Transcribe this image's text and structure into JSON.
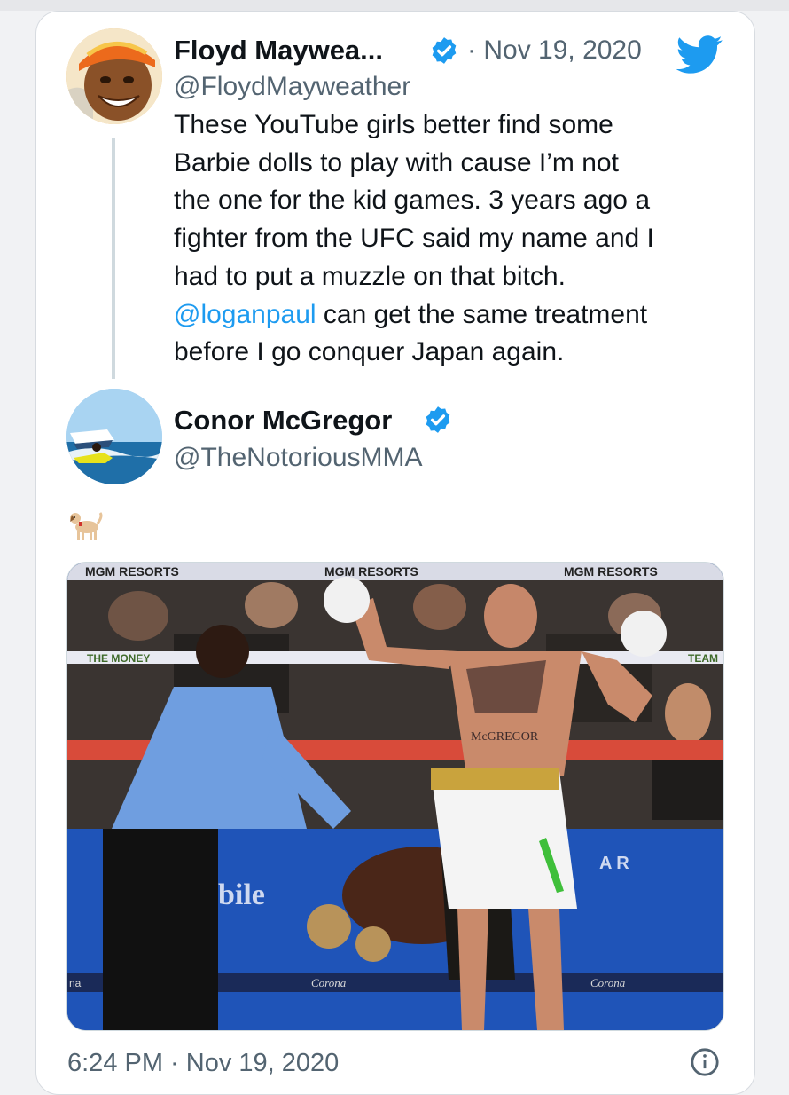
{
  "tweet": {
    "author_name": "Floyd Maywea...",
    "author_handle": "@FloydMayweather",
    "separator": "·",
    "date": "Nov 19, 2020",
    "body_lines": [
      "These YouTube girls better find some",
      "Barbie dolls to play with cause I’m not",
      "the one for the kid games. 3 years ago a",
      "fighter from the UFC said my name and I",
      "had to put a muzzle on that bitch."
    ],
    "mention": "@loganpaul",
    "mention_rest": " can get the same treatment",
    "last_line": "before I go conquer Japan again.",
    "icons": {
      "avatar": "avatar",
      "verified": "verified-badge-icon",
      "platform": "twitter-bird-icon"
    }
  },
  "reply": {
    "author_name": "Conor McGregor",
    "author_handle": "@TheNotoriousMMA",
    "emoji": "dog-emoji",
    "photo": {
      "banner_left": "MGM RESORTS",
      "banner_center": "MGM RESORTS",
      "banner_right": "MGM RESORTS",
      "rope_text_left": "THE MONEY",
      "rope_text_right": "TEAM",
      "boxer_waistband": "McGREGOR",
      "mat_text_left": "bile",
      "mat_text_right": "A R",
      "sponsor_left": "Corona",
      "sponsor_right": "Corona",
      "post_pad": "na"
    }
  },
  "footer": {
    "timestamp": "6:24 PM · Nov 19, 2020"
  },
  "colors": {
    "accent": "#1d9bf0",
    "secondary_text": "#536471",
    "primary_text": "#0f1419"
  }
}
